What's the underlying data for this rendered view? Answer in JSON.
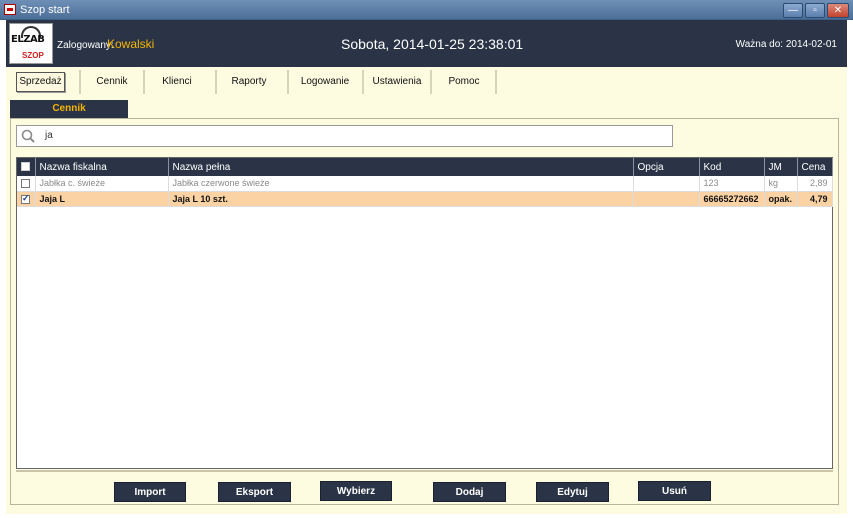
{
  "window": {
    "title": "Szop start",
    "min_label": "—",
    "max_label": "▫",
    "close_label": "✕"
  },
  "header": {
    "logo_text": "ELZAB",
    "logo_sub": "SZOP",
    "login_label": "Zalogowany:",
    "user": "Kowalski",
    "datetime": "Sobota, 2014-01-25 23:38:01",
    "valid_until": "Ważna do: 2014-02-01"
  },
  "nav": [
    "Sprzedaż",
    "Cennik",
    "Klienci",
    "Raporty",
    "Logowanie",
    "Ustawienia",
    "Pomoc"
  ],
  "section_tab": "Cennik",
  "search": {
    "value": "ja"
  },
  "table": {
    "columns": [
      "Nazwa fiskalna",
      "Nazwa pełna",
      "Opcja",
      "Kod",
      "JM",
      "Cena"
    ],
    "rows": [
      {
        "checked": false,
        "fiscal": "Jabłka c. świeże",
        "full": "Jabłka czerwone świeże",
        "option": "",
        "code": "123",
        "unit": "kg",
        "price": "2,89"
      },
      {
        "checked": true,
        "fiscal": "Jaja L",
        "full": "Jaja L 10 szt.",
        "option": "",
        "code": "66665272662",
        "unit": "opak.",
        "price": "4,79"
      }
    ]
  },
  "actions": [
    "Import",
    "Eksport",
    "Wybierz",
    "Dodaj",
    "Edytuj",
    "Usuń"
  ],
  "colors": {
    "header_bg": "#2a3446",
    "accent": "#f5b400",
    "selected_row": "#fad2a3",
    "main_bg": "#fdfbe0"
  }
}
